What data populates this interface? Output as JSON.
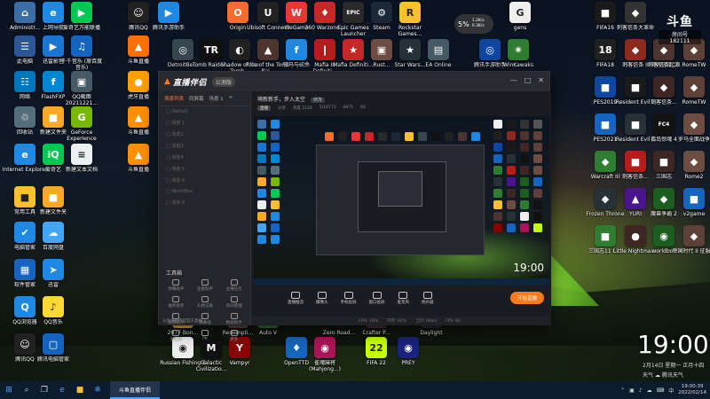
{
  "desktop_icons": [
    {
      "label": "Administr...",
      "color": "#3a6ea5",
      "glyph": "⌂"
    },
    {
      "label": "上网导航",
      "color": "#1e88e5",
      "glyph": "e"
    },
    {
      "label": "爱奇艺万能联播",
      "color": "#00c853",
      "glyph": "▶"
    },
    {
      "label": "此电脑",
      "color": "#2b5797",
      "glyph": "☰"
    },
    {
      "label": "迅雷影音",
      "color": "#1976d2",
      "glyph": "▶"
    },
    {
      "label": "千千音乐 (原百度音乐)",
      "color": "#1565c0",
      "glyph": "♫"
    },
    {
      "label": "网络",
      "color": "#0277bd",
      "glyph": "☷"
    },
    {
      "label": "FlashFXP",
      "color": "#0288d1",
      "glyph": "f"
    },
    {
      "label": "QQ截图 20211221...",
      "color": "#455a64",
      "glyph": "▣"
    },
    {
      "label": "回收站",
      "color": "#546e7a",
      "glyph": "♲"
    },
    {
      "label": "新建文件夹",
      "color": "#f9a825",
      "glyph": "■"
    },
    {
      "label": "GeForce Experience",
      "color": "#76b900",
      "glyph": "G"
    },
    {
      "label": "Internet Explorer",
      "color": "#1e88e5",
      "glyph": "e"
    },
    {
      "label": "爱奇艺",
      "color": "#00c853",
      "glyph": "iQ"
    },
    {
      "label": "新建文本文档",
      "color": "#eceff1",
      "glyph": "≡"
    },
    {
      "label": "常用工具",
      "color": "#fbc02d",
      "glyph": "■"
    },
    {
      "label": "新建文件夹",
      "color": "#f9a825",
      "glyph": "■"
    },
    {
      "label": "电脑管家",
      "color": "#1e88e5",
      "glyph": "✔"
    },
    {
      "label": "百度网盘",
      "color": "#42a5f5",
      "glyph": "☁"
    },
    {
      "label": "软件管家",
      "color": "#1565c0",
      "glyph": "▦"
    },
    {
      "label": "迅雷",
      "color": "#1e88e5",
      "glyph": "➤"
    },
    {
      "label": "QQ浏览器",
      "color": "#1e88e5",
      "glyph": "Q"
    },
    {
      "label": "QQ音乐",
      "color": "#fdd835",
      "glyph": "♪"
    },
    {
      "label": "腾讯QQ",
      "color": "#212121",
      "glyph": "☺"
    },
    {
      "label": "腾讯电脑管家",
      "color": "#1565c0",
      "glyph": "▢"
    },
    {
      "label": "腾讯QQ",
      "color": "#212121",
      "glyph": "☺"
    },
    {
      "label": "斗鱼直播",
      "color": "#ff6f00",
      "glyph": "▲"
    },
    {
      "label": "虎牙直播",
      "color": "#ffa000",
      "glyph": "●"
    },
    {
      "label": "斗鱼直播",
      "color": "#ff8f00",
      "glyph": "▲"
    },
    {
      "label": "斗鱼直播",
      "color": "#ff8f00",
      "glyph": "▲"
    },
    {
      "label": "腾讯手游助手",
      "color": "#1e88e5",
      "glyph": "▶"
    },
    {
      "label": "Origin",
      "color": "#f56c2d",
      "glyph": "O"
    },
    {
      "label": "Ubisoft Connect",
      "color": "#222",
      "glyph": "U"
    },
    {
      "label": "WeGame",
      "color": "#e53935",
      "glyph": "W"
    },
    {
      "label": "360 Warzone...",
      "color": "#c62828",
      "glyph": "♦"
    },
    {
      "label": "Epic Games Launcher",
      "color": "#2a2a2a",
      "glyph": "EPIC"
    },
    {
      "label": "Steam",
      "color": "#1b2838",
      "glyph": "⚙"
    },
    {
      "label": "Rockstar Games...",
      "color": "#fbc02d",
      "glyph": "R"
    },
    {
      "label": "DetroitBe...",
      "color": "#37474f",
      "glyph": "◎"
    },
    {
      "label": "Tomb Raider...",
      "color": "#111",
      "glyph": "TR"
    },
    {
      "label": "Shadow of the Tomb...",
      "color": "#212121",
      "glyph": "◐"
    },
    {
      "label": "Rise of the Tomb Rai...",
      "color": "#4e342e",
      "glyph": "▲"
    },
    {
      "label": "骑马与砍杀",
      "color": "#1e88e5",
      "glyph": "f"
    },
    {
      "label": "Mafia III Definiti...",
      "color": "#b71c1c",
      "glyph": "❙"
    },
    {
      "label": "Mafia Definiti...",
      "color": "#c62828",
      "glyph": "★"
    },
    {
      "label": "Rust...",
      "color": "#6d4c41",
      "glyph": "▣"
    },
    {
      "label": "Star Wars...",
      "color": "#263238",
      "glyph": "★"
    },
    {
      "label": "EA Online",
      "color": "#455a64",
      "glyph": "▤"
    },
    {
      "label": "腾讯手游助手",
      "color": "#0d47a1",
      "glyph": "◎"
    },
    {
      "label": "WinKawaks",
      "color": "#2e7d32",
      "glyph": "✷"
    },
    {
      "label": "gens",
      "color": "#eeeeee",
      "glyph": "G"
    },
    {
      "label": "FIFA16",
      "color": "#1a1a1a",
      "glyph": "■"
    },
    {
      "label": "刺客信条大革命",
      "color": "#333",
      "glyph": "◆"
    },
    {
      "label": "刺客信条...",
      "color": "#555",
      "glyph": "◆"
    },
    {
      "label": "FIFA18",
      "color": "#202020",
      "glyph": "18"
    },
    {
      "label": "刺客信条 II",
      "color": "#8d2a1f",
      "glyph": "◆"
    },
    {
      "label": "刺客信条起源",
      "color": "#4e342e",
      "glyph": "◆"
    },
    {
      "label": "RomeTW",
      "color": "#5d4037",
      "glyph": "◆"
    },
    {
      "label": "PES2019",
      "color": "#0d47a1",
      "glyph": "■"
    },
    {
      "label": "Resident Evil 2",
      "color": "#1a1a1a",
      "glyph": "■"
    },
    {
      "label": "刺客信条...",
      "color": "#3e2723",
      "glyph": "◆"
    },
    {
      "label": "RomeTW",
      "color": "#5d4037",
      "glyph": "◆"
    },
    {
      "label": "PES2021",
      "color": "#1565c0",
      "glyph": "■"
    },
    {
      "label": "Resident Evil 3",
      "color": "#263238",
      "glyph": "■"
    },
    {
      "label": "孤岛惊魂 4",
      "color": "#111",
      "glyph": "FC4"
    },
    {
      "label": "罗马全面战争",
      "color": "#6d4c41",
      "glyph": "◆"
    },
    {
      "label": "Warcraft III",
      "color": "#2e7d32",
      "glyph": "◆"
    },
    {
      "label": "刺客信条...",
      "color": "#b71c1c",
      "glyph": "■"
    },
    {
      "label": "三国志",
      "color": "#3e2723",
      "glyph": "■"
    },
    {
      "label": "Rome2",
      "color": "#6d4c41",
      "glyph": "◆"
    },
    {
      "label": "Frozen Throne",
      "color": "#263238",
      "glyph": "◆"
    },
    {
      "label": "YURI",
      "color": "#4a148c",
      "glyph": "▲"
    },
    {
      "label": "魔兽争霸 2",
      "color": "#1b5e20",
      "glyph": "◆"
    },
    {
      "label": "v2game",
      "color": "#1565c0",
      "glyph": "■"
    },
    {
      "label": "三国志11 (...)",
      "color": "#2e7d32",
      "glyph": "■"
    },
    {
      "label": "Little Nightmar...",
      "color": "#3e2723",
      "glyph": "●"
    },
    {
      "label": "worldbox",
      "color": "#1b5e20",
      "glyph": "◉"
    },
    {
      "label": "帝国时代 II 征服者",
      "color": "#5d4037",
      "glyph": "◆"
    },
    {
      "label": "2077 Bon...",
      "color": "#fbc02d",
      "glyph": "■"
    },
    {
      "label": "Redempti...",
      "color": "#6d4c41",
      "glyph": "■"
    },
    {
      "label": "Auto V",
      "color": "#2e7d32",
      "glyph": "V"
    },
    {
      "label": "Zero Road...",
      "color": "#111",
      "glyph": "■"
    },
    {
      "label": "Crafter P...",
      "color": "#4e342e",
      "glyph": "■"
    },
    {
      "label": "Daylight",
      "color": "#263238",
      "glyph": "■"
    },
    {
      "label": "Russian Fishing 4",
      "color": "#eeeeee",
      "glyph": "◉"
    },
    {
      "label": "Galactic Civilizatio...",
      "color": "#111",
      "glyph": "M"
    },
    {
      "label": "Vampyr",
      "color": "#8b0000",
      "glyph": "Y"
    },
    {
      "label": "OpenTTD",
      "color": "#1565c0",
      "glyph": "♦"
    },
    {
      "label": "雀魂麻将 (Mahjong...)",
      "color": "#ad1457",
      "glyph": "◉"
    },
    {
      "label": "FIFA 22",
      "color": "#c6ff00",
      "glyph": "22"
    },
    {
      "label": "PREY",
      "color": "#1a237e",
      "glyph": "◉"
    }
  ],
  "net_widget": {
    "percent": "5%",
    "up": "1.2K/s",
    "down": "0.3K/s"
  },
  "douyu_logo": {
    "title": "斗鱼",
    "room": "房间号",
    "room_no": "182111"
  },
  "stream_window": {
    "app_name": "直播伴侣",
    "version_badge": "公测版",
    "controls": [
      "—",
      "□",
      "✕"
    ],
    "left_tabs": [
      "场景列表",
      "同屏幕",
      "场景 1",
      "+"
    ],
    "scenes": [
      "Default",
      "场景 1",
      "场景2",
      "场景3",
      "场景4",
      "场景 5",
      "场景 6",
      "WorldBox",
      "场景 8"
    ],
    "tools_title": "工具箱",
    "tools": [
      "弹幕助手",
      "连麦助手",
      "主播任务",
      "抽奖助手",
      "礼物记录",
      "房间管理",
      "投票助手",
      "弹幕墙",
      "数据助手",
      "发红包",
      "PK",
      "更多"
    ],
    "status": "斗鱼直播伴侣官方直播",
    "room_title": "萌新新手，步入太空",
    "room_tag": "修改",
    "stats": [
      "分享",
      "热度 3126",
      "5/18773",
      "6671",
      "60"
    ],
    "live_tag": "直播",
    "preview_clock": "19:00",
    "actions": [
      "直播推流",
      "摄像头",
      "手机投屏",
      "窗口投屏",
      "麦克风",
      "扬声器"
    ],
    "go_live": "开始直播",
    "footer": [
      "CPU: 18%",
      "内存: 62%",
      "上行: 0kb/s",
      "FPS: 60"
    ]
  },
  "clock": {
    "time": "19:00",
    "date": "2月14日 星期一  正月十四",
    "weather": "天气  ☁  腾讯天气"
  },
  "taskbar": {
    "start": "⊞",
    "search": "⌕",
    "task_view": "❐",
    "pinned": [
      "e",
      "■",
      "❄"
    ],
    "active_app": "斗鱼直播伴侣",
    "tray_icons": [
      "⌃",
      "▣",
      "♪",
      "☁",
      "⌨",
      "中"
    ],
    "tray_time": "19:00:39",
    "tray_date": "2022/02/14"
  }
}
